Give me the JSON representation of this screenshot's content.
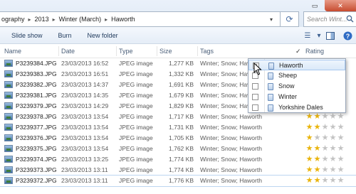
{
  "address": {
    "crumbs": [
      "ography",
      "2013",
      "Winter (March)",
      "Haworth"
    ]
  },
  "search": {
    "placeholder": "Search Wint..."
  },
  "toolbar": {
    "slideshow_label": "Slide show",
    "burn_label": "Burn",
    "new_folder_label": "New folder"
  },
  "columns": {
    "name": "Name",
    "date": "Date",
    "type": "Type",
    "size": "Size",
    "tags": "Tags",
    "rating": "Rating"
  },
  "files": [
    {
      "name": "P3239384.JPG",
      "date": "23/03/2013 16:52",
      "type": "JPEG image",
      "size": "1,277 KB",
      "tags": "Winter; Snow; Hav",
      "rating": null
    },
    {
      "name": "P3239383.JPG",
      "date": "23/03/2013 16:51",
      "type": "JPEG image",
      "size": "1,332 KB",
      "tags": "Winter; Snow; Hav",
      "rating": null
    },
    {
      "name": "P3239382.JPG",
      "date": "23/03/2013 14:37",
      "type": "JPEG image",
      "size": "1,691 KB",
      "tags": "Winter; Snow; Hav",
      "rating": null
    },
    {
      "name": "P3239381.JPG",
      "date": "23/03/2013 14:35",
      "type": "JPEG image",
      "size": "1,679 KB",
      "tags": "Winter; Snow; Hav",
      "rating": null
    },
    {
      "name": "P3239379.JPG",
      "date": "23/03/2013 14:29",
      "type": "JPEG image",
      "size": "1,829 KB",
      "tags": "Winter; Snow; Hav",
      "rating": null
    },
    {
      "name": "P3239378.JPG",
      "date": "23/03/2013 13:54",
      "type": "JPEG image",
      "size": "1,717 KB",
      "tags": "Winter; Snow; Haworth",
      "rating": 2
    },
    {
      "name": "P3239377.JPG",
      "date": "23/03/2013 13:54",
      "type": "JPEG image",
      "size": "1,731 KB",
      "tags": "Winter; Snow; Haworth",
      "rating": 2
    },
    {
      "name": "P3239376.JPG",
      "date": "23/03/2013 13:54",
      "type": "JPEG image",
      "size": "1,705 KB",
      "tags": "Winter; Snow; Haworth",
      "rating": 1
    },
    {
      "name": "P3239375.JPG",
      "date": "23/03/2013 13:54",
      "type": "JPEG image",
      "size": "1,762 KB",
      "tags": "Winter; Snow; Haworth",
      "rating": 2
    },
    {
      "name": "P3239374.JPG",
      "date": "23/03/2013 13:25",
      "type": "JPEG image",
      "size": "1,774 KB",
      "tags": "Winter; Snow; Haworth",
      "rating": 2
    },
    {
      "name": "P3239373.JPG",
      "date": "23/03/2013 13:11",
      "type": "JPEG image",
      "size": "1,774 KB",
      "tags": "Winter; Snow; Haworth",
      "rating": 2
    },
    {
      "name": "P3239372.JPG",
      "date": "23/03/2013 13:11",
      "type": "JPEG image",
      "size": "1,776 KB",
      "tags": "Winter; Snow; Haworth",
      "rating": 2
    }
  ],
  "tag_menu": [
    {
      "label": "Haworth",
      "checked": true
    },
    {
      "label": "Sheep",
      "checked": false
    },
    {
      "label": "Snow",
      "checked": false
    },
    {
      "label": "Winter",
      "checked": false
    },
    {
      "label": "Yorkshire Dales",
      "checked": false
    }
  ],
  "colors": {
    "star_on": "#e9b40b",
    "star_off": "#c3c3c3",
    "close_button": "#c74b2f"
  }
}
